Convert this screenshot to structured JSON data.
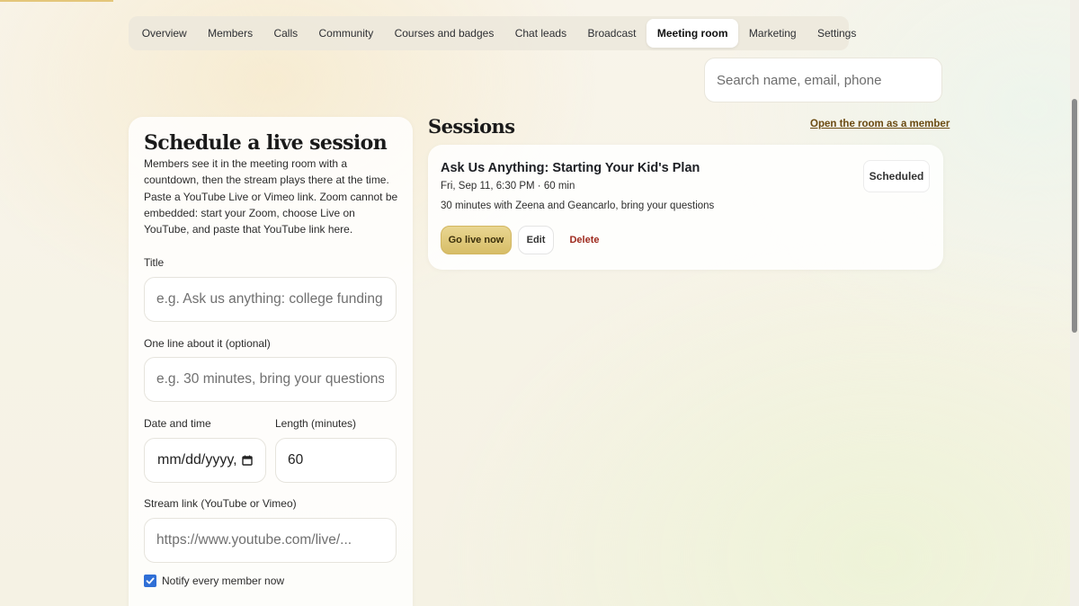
{
  "tabs": [
    {
      "label": "Overview"
    },
    {
      "label": "Members"
    },
    {
      "label": "Calls"
    },
    {
      "label": "Community"
    },
    {
      "label": "Courses and badges"
    },
    {
      "label": "Chat leads"
    },
    {
      "label": "Broadcast"
    },
    {
      "label": "Meeting room",
      "active": true
    },
    {
      "label": "Marketing"
    },
    {
      "label": "Settings"
    }
  ],
  "search": {
    "placeholder": "Search name, email, phone"
  },
  "schedule": {
    "title": "Schedule a live session",
    "description": "Members see it in the meeting room with a countdown, then the stream plays there at the time. Paste a YouTube Live or Vimeo link. Zoom cannot be embedded: start your Zoom, choose Live on YouTube, and paste that YouTube link here.",
    "title_label": "Title",
    "title_placeholder": "e.g. Ask us anything: college funding vs",
    "oneline_label": "One line about it (optional)",
    "oneline_placeholder": "e.g. 30 minutes, bring your questions",
    "date_label": "Date and time",
    "date_value": "mm/dd/yyyy, --:-- --",
    "date_display": "mm/dd/yyyy,",
    "length_label": "Length (minutes)",
    "length_value": "60",
    "stream_label": "Stream link (YouTube or Vimeo)",
    "stream_placeholder": "https://www.youtube.com/live/...",
    "notify_label": "Notify every member now",
    "notify_checked": true
  },
  "sessions": {
    "title": "Sessions",
    "open_link": "Open the room as a member",
    "items": [
      {
        "name": "Ask Us Anything: Starting Your Kid's Plan",
        "when": "Fri, Sep 11, 6:30 PM · 60 min",
        "description": "30 minutes with Zeena and Geancarlo, bring your questions",
        "status": "Scheduled",
        "go_live_label": "Go live now",
        "edit_label": "Edit",
        "delete_label": "Delete"
      }
    ]
  },
  "colors": {
    "accent_gold": "#d7bd67",
    "link_brown": "#6b4a12",
    "delete_red": "#9e2a1e",
    "checkbox_blue": "#2f6fd6"
  }
}
